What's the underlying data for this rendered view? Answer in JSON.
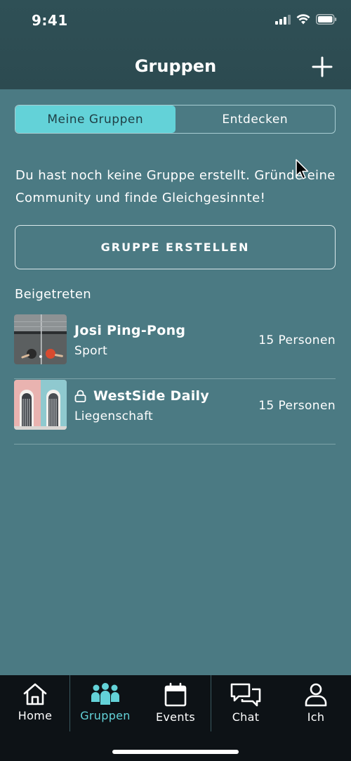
{
  "status_bar": {
    "time": "9:41"
  },
  "header": {
    "title": "Gruppen"
  },
  "segments": {
    "mine": "Meine Gruppen",
    "discover": "Entdecken"
  },
  "empty_state": {
    "message": "Du hast noch keine Gruppe erstellt. Gründe eine Community und finde Gleichgesinnte!",
    "create_button": "GRUPPE ERSTELLEN"
  },
  "joined": {
    "title": "Beigetreten",
    "groups": [
      {
        "name": "Josi Ping-Pong",
        "category": "Sport",
        "members": "15 Personen",
        "locked": false
      },
      {
        "name": "WestSide Daily",
        "category": "Liegenschaft",
        "members": "15 Personen",
        "locked": true
      }
    ]
  },
  "tabbar": {
    "items": [
      {
        "label": "Home",
        "icon": "home-icon"
      },
      {
        "label": "Gruppen",
        "icon": "groups-icon",
        "active": true
      },
      {
        "label": "Events",
        "icon": "calendar-icon"
      },
      {
        "label": "Chat",
        "icon": "chat-icon"
      },
      {
        "label": "Ich",
        "icon": "person-icon"
      }
    ]
  },
  "colors": {
    "accent": "#63d2d8",
    "background": "#4b7a83",
    "header": "#2f5056",
    "tabbar": "#0d1216"
  }
}
